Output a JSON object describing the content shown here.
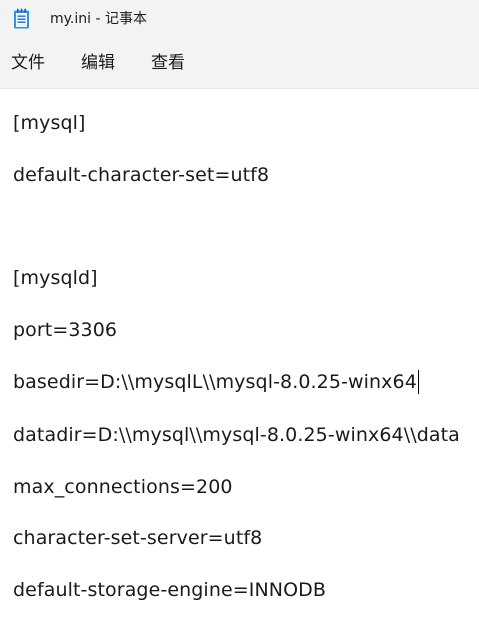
{
  "window": {
    "title": "my.ini - 记事本",
    "app_icon": "notepad-icon"
  },
  "menu": {
    "file": "文件",
    "edit": "编辑",
    "view": "查看"
  },
  "editor": {
    "lines": [
      "[mysql]",
      "default-character-set=utf8",
      "",
      "[mysqld]",
      "port=3306",
      "basedir=D:\\\\mysqlL\\\\mysql-8.0.25-winx64",
      "datadir=D:\\\\mysql\\\\mysql-8.0.25-winx64\\\\data",
      "max_connections=200",
      "character-set-server=utf8",
      "default-storage-engine=INNODB"
    ]
  }
}
